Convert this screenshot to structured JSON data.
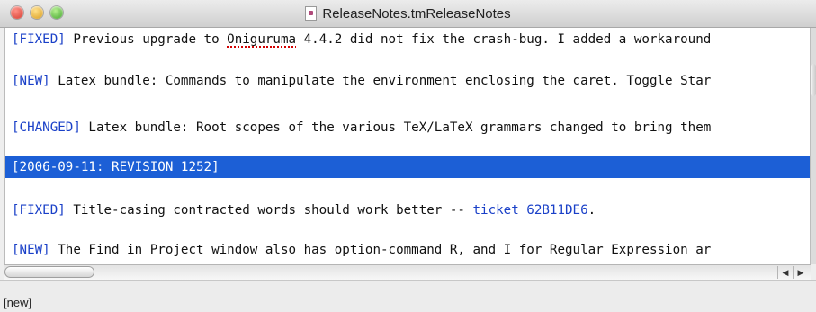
{
  "window": {
    "title": "ReleaseNotes.tmReleaseNotes"
  },
  "editor": {
    "lines": [
      {
        "tag": "[FIXED]",
        "text_before": " Previous upgrade to ",
        "misspelled": "Oniguruma",
        "text_after": " 4.4.2 did not fix the crash-bug. I added a workaround"
      },
      {
        "tag": "[NEW]",
        "text": " Latex bundle: Commands to manipulate the environment enclosing the caret. Toggle Star"
      },
      {
        "tag": "[CHANGED]",
        "text": " Latex bundle: Root scopes of the various TeX/LaTeX grammars changed to bring them"
      },
      {
        "text": "[2006-09-11: REVISION 1252]",
        "selected": true
      },
      {
        "tag": "[FIXED]",
        "text": " Title-casing contracted words should work better -- ",
        "link": "ticket 62B11DE6",
        "text_after": "."
      },
      {
        "tag": "[NEW]",
        "text": " The Find in Project window also has option-command R, and I for Regular Expression ar"
      }
    ]
  },
  "statusbar": {
    "text": "[new]"
  },
  "icons": {
    "document": "document-icon",
    "close": "close-button",
    "minimize": "minimize-button",
    "zoom": "zoom-button"
  }
}
